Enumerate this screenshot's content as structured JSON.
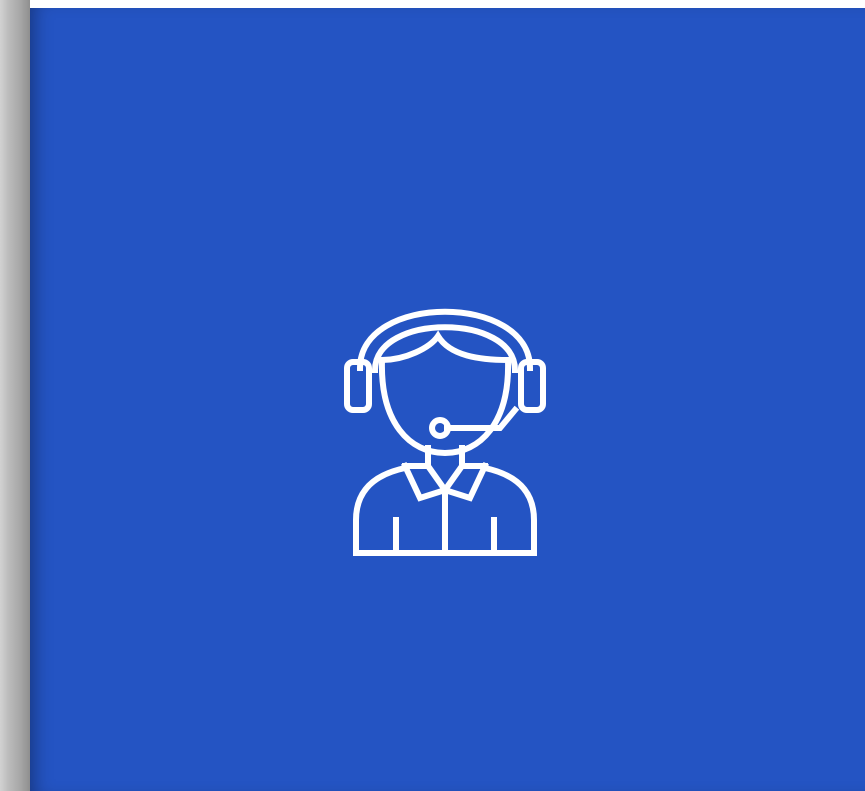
{
  "tile": {
    "background_color": "#2454c3",
    "icon": "customer-support-agent-icon",
    "icon_color": "#ffffff"
  }
}
